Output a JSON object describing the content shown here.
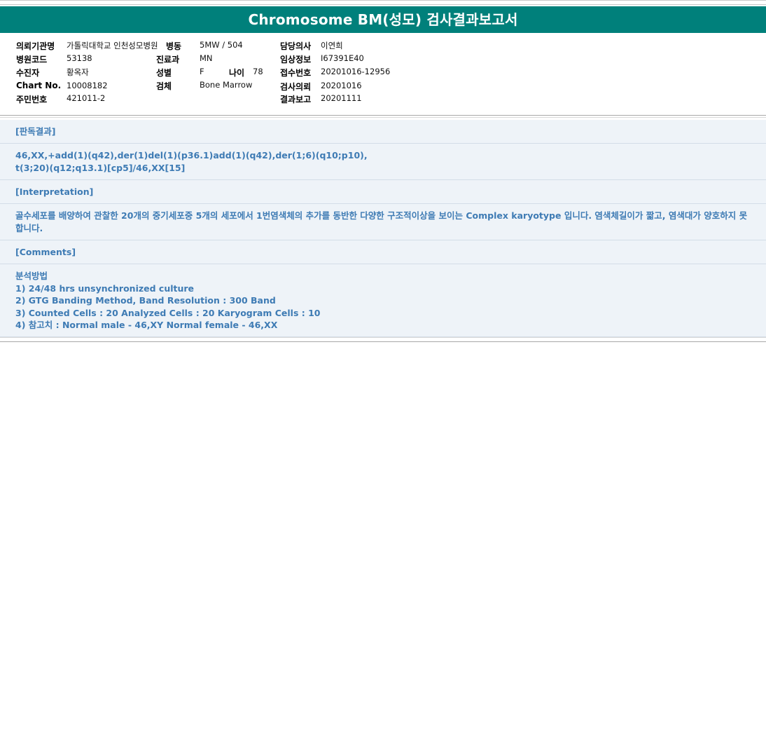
{
  "title": "Chromosome BM(성모) 검사결과보고서",
  "info": {
    "request_org": {
      "label": "의뢰기관명",
      "value": "가톨릭대학교 인천성모병원"
    },
    "hospital_code": {
      "label": "병원코드",
      "value": "53138"
    },
    "patient_name": {
      "label": "수진자",
      "value": "황옥자"
    },
    "chart_no": {
      "label": "Chart No.",
      "value": "10008182"
    },
    "resident_no": {
      "label": "주민번호",
      "value": "421011-2"
    },
    "ward": {
      "label": "병동",
      "value": "5MW / 504"
    },
    "department": {
      "label": "진료과",
      "value": "MN"
    },
    "sex": {
      "label": "성별",
      "value": "F"
    },
    "age": {
      "label": "나이",
      "value": "78"
    },
    "specimen": {
      "label": "검체",
      "value": "Bone Marrow"
    },
    "doctor": {
      "label": "담당의사",
      "value": "이연희"
    },
    "clinical_info": {
      "label": "임상정보",
      "value": "I67391E40"
    },
    "receipt_no": {
      "label": "접수번호",
      "value": "20201016-12956"
    },
    "request_date": {
      "label": "검사의뢰",
      "value": "20201016"
    },
    "report_date": {
      "label": "결과보고",
      "value": "20201111"
    }
  },
  "sections": {
    "result_head": "[판독결과]",
    "result_line1": "46,XX,+add(1)(q42),der(1)del(1)(p36.1)add(1)(q42),der(1;6)(q10;p10),",
    "result_line2": "t(3;20)(q12;q13.1)[cp5]/46,XX[15]",
    "interp_head": "[Interpretation]",
    "interp_line1": "골수세포를 배양하여 관찰한 20개의 중기세포중 5개의 세포에서 1번염색체의 추가를 동반한 다양한 구조적이상을 보이는 Complex karyotype 입니다. 염색체길이가 짧고, 염색대가 양호하지 못",
    "interp_line2": "합니다.",
    "comments_head": "[Comments]",
    "method_title": "분석방법",
    "method_1": "1) 24/48 hrs unsynchronized culture",
    "method_2": "2) GTG Banding Method, Band Resolution : 300 Band",
    "method_3": "3) Counted Cells : 20 Analyzed Cells : 20 Karyogram Cells : 10",
    "method_4": "4) 참고치 : Normal male - 46,XY Normal female - 46,XX"
  }
}
